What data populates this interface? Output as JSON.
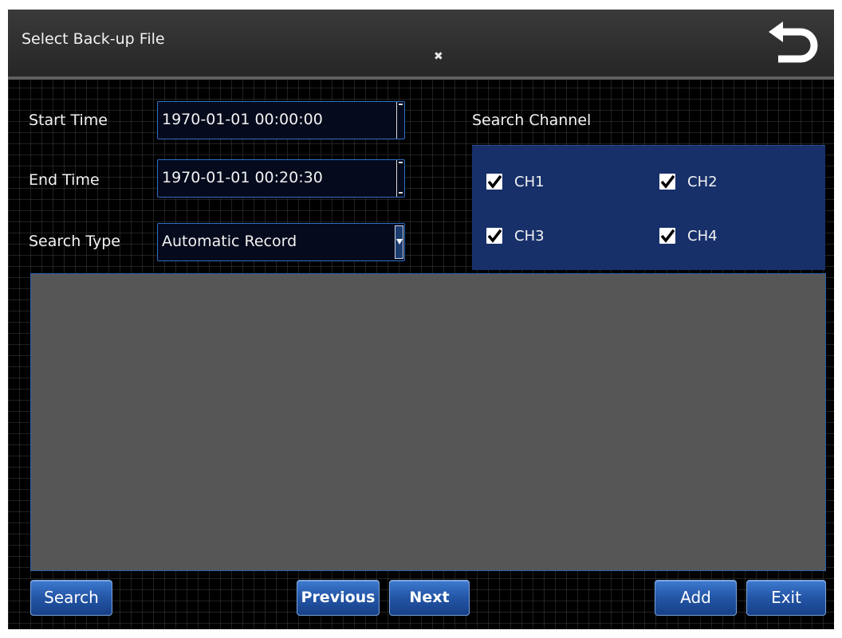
{
  "window": {
    "title": "Select Back-up File",
    "cursor_glyph": "⌖",
    "back_icon": "return-arrow-icon"
  },
  "form": {
    "start_time_label": "Start Time",
    "start_time_value": "1970-01-01 00:00:00",
    "end_time_label": "End  Time",
    "end_time_value": "1970-01-01 00:20:30",
    "search_type_label": "Search Type",
    "search_type_value": "Automatic Record"
  },
  "channels": {
    "label": "Search Channel",
    "items": [
      {
        "label": "CH1",
        "checked": true
      },
      {
        "label": "CH2",
        "checked": true
      },
      {
        "label": "CH3",
        "checked": true
      },
      {
        "label": "CH4",
        "checked": true
      }
    ]
  },
  "buttons": {
    "search": "Search",
    "previous": "Previous",
    "next": "Next",
    "add": "Add",
    "exit": "Exit"
  },
  "colors": {
    "background": "#000000",
    "panel_blue": "#17306a",
    "field_border": "#2f6fc2",
    "button_blue": "#2558a9",
    "results_gray": "#565656"
  }
}
